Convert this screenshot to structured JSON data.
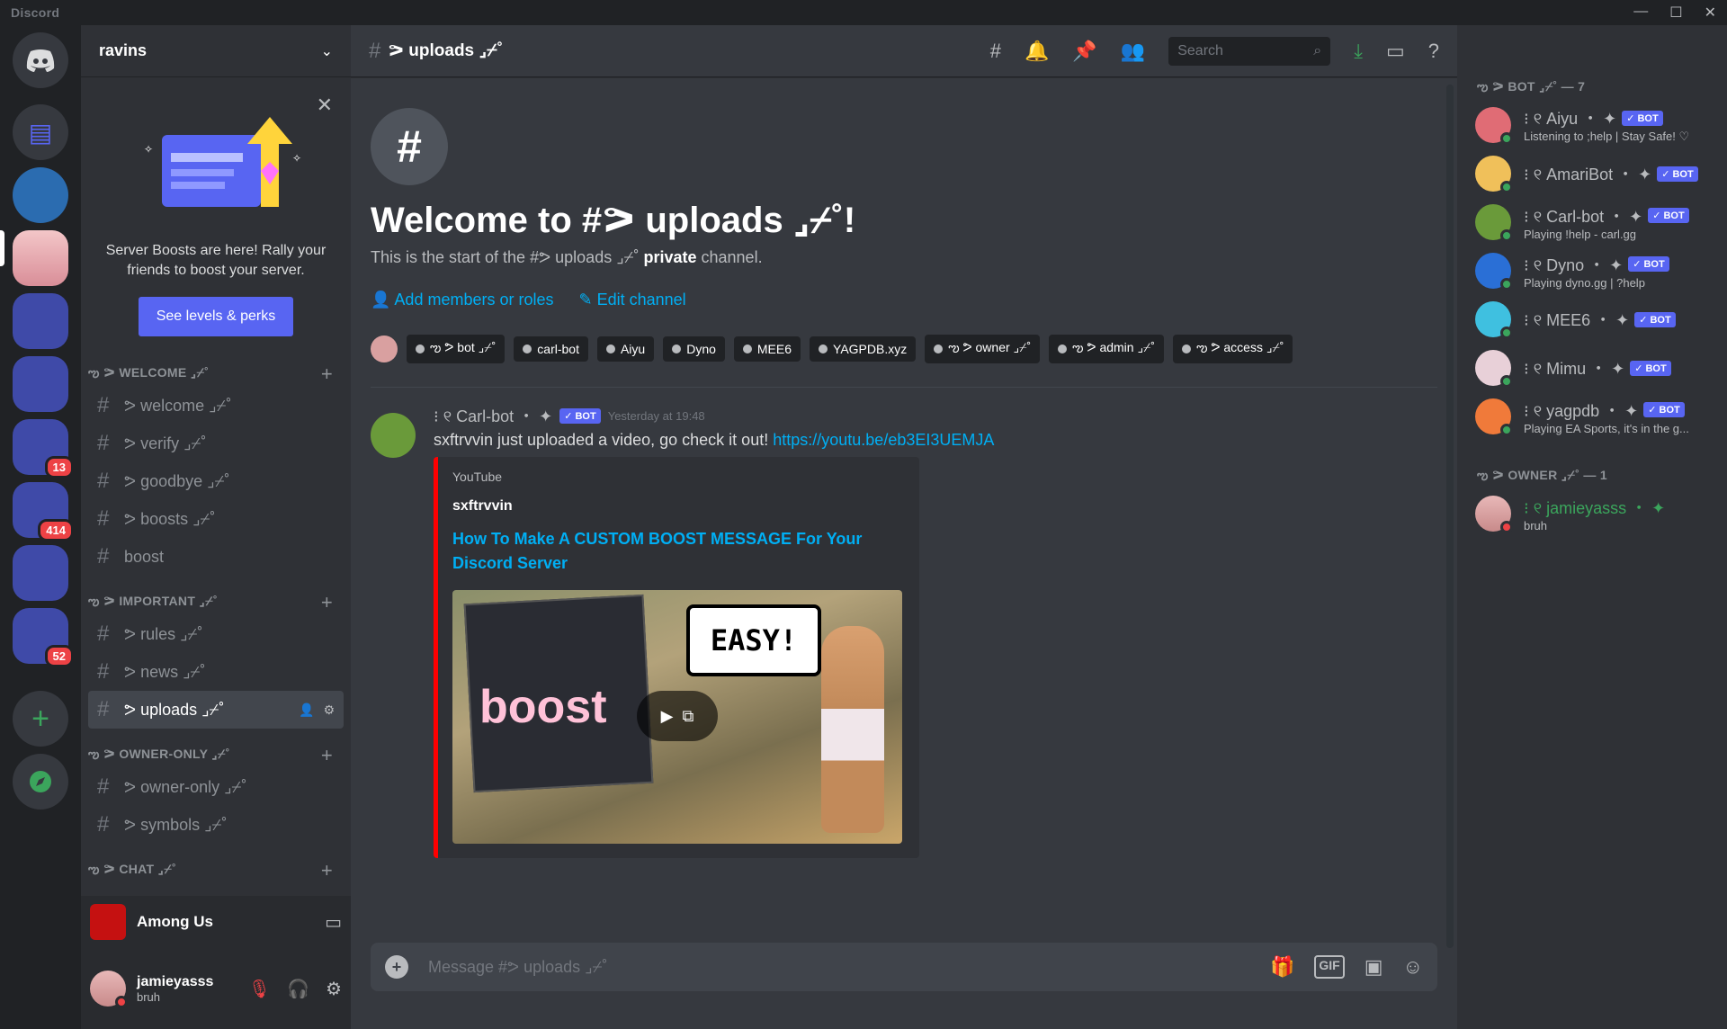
{
  "app": {
    "brand": "Discord"
  },
  "window_controls": [
    "—",
    "☐",
    "✕"
  ],
  "server": {
    "name": "ravins"
  },
  "boost_card": {
    "text": "Server Boosts are here! Rally your friends to boost your server.",
    "button": "See levels & perks"
  },
  "guild_badges": {
    "g1": "13",
    "g2": "414",
    "g3": "52"
  },
  "categories": [
    {
      "name": "ఌ ᕗ WELCOME ⌟⌿˚",
      "channels": [
        {
          "name": "ᕗ welcome ⌟⌿˚"
        },
        {
          "name": "ᕗ verify ⌟⌿˚"
        },
        {
          "name": "ᕗ goodbye ⌟⌿˚"
        },
        {
          "name": "ᕗ boosts ⌟⌿˚"
        },
        {
          "name": "boost"
        }
      ]
    },
    {
      "name": "ఌ ᕗ IMPORTANT ⌟⌿˚",
      "channels": [
        {
          "name": "ᕗ rules ⌟⌿˚"
        },
        {
          "name": "ᕗ news ⌟⌿˚"
        },
        {
          "name": "ᕗ uploads ⌟⌿˚"
        }
      ]
    },
    {
      "name": "ఌ ᕗ OWNER-ONLY ⌟⌿˚",
      "channels": [
        {
          "name": "ᕗ owner-only ⌟⌿˚"
        },
        {
          "name": "ᕗ symbols ⌟⌿˚"
        }
      ]
    },
    {
      "name": "ఌ ᕗ CHAT ⌟⌿˚",
      "channels": []
    }
  ],
  "voice": {
    "activity": "Among Us"
  },
  "user": {
    "name": "jamieyasss",
    "status": "bruh"
  },
  "channel_header": {
    "title": "ᕗ uploads ⌟⌿˚",
    "search_placeholder": "Search"
  },
  "welcome": {
    "title": "Welcome to #ᕗ uploads ⌟⌿˚!",
    "sub_prefix": "This is the start of the #ᕗ uploads ⌟⌿˚",
    "sub_strong": "private",
    "sub_suffix": "channel.",
    "add_members": "Add members or roles",
    "edit_channel": "Edit channel"
  },
  "roles": [
    "ఌ ᕗ bot ⌟⌿˚",
    "carl-bot",
    "Aiyu",
    "Dyno",
    "MEE6",
    "YAGPDB.xyz",
    "ఌ ᕗ owner ⌟⌿˚",
    "ఌ ᕗ admin ⌟⌿˚",
    "ఌ ᕗ access ⌟⌿˚"
  ],
  "message": {
    "author": "⁝ ୧ Carl-bot ・ ✦",
    "badge": "✓ BOT",
    "timestamp": "Yesterday at 19:48",
    "text": "sxftrvvin just uploaded a video, go check it out!",
    "link": "https://youtu.be/eb3EI3UEMJA",
    "embed": {
      "provider": "YouTube",
      "author": "sxftrvvin",
      "title": "How To Make A CUSTOM BOOST MESSAGE For Your Discord Server",
      "thumb_caption": "EASY!",
      "thumb_word": "boost"
    }
  },
  "composer": {
    "placeholder": "Message #ᕗ uploads ⌟⌿˚",
    "gif": "GIF"
  },
  "members": {
    "bot_header": "ఌ ᕗ BOT ⌟⌿˚ — 7",
    "bots": [
      {
        "name": "⁝ ୧ Aiyu ・ ✦",
        "activity": "Listening to ;help | Stay Safe! ♡",
        "color": "#e06c75"
      },
      {
        "name": "⁝ ୧ AmariBot ・ ✦",
        "activity": "",
        "color": "#f0c05a"
      },
      {
        "name": "⁝ ୧ Carl-bot ・ ✦",
        "activity": "Playing !help - carl.gg",
        "color": "#6a9a3a"
      },
      {
        "name": "⁝ ୧ Dyno ・ ✦",
        "activity": "Playing dyno.gg | ?help",
        "color": "#2a6fd6"
      },
      {
        "name": "⁝ ୧ MEE6 ・ ✦",
        "activity": "",
        "color": "#3fc0e0"
      },
      {
        "name": "⁝ ୧ Mimu ・ ✦",
        "activity": "",
        "color": "#e8d0d8"
      },
      {
        "name": "⁝ ୧ yagpdb ・ ✦",
        "activity": "Playing EA Sports, it's in the g...",
        "color": "#f07a3a"
      }
    ],
    "bot_badge": "✓ BOT",
    "owner_header": "ఌ ᕗ OWNER ⌟⌿˚ — 1",
    "owner": {
      "name": "⁝ ୧ jamieyasss ・ ✦",
      "activity": "bruh"
    }
  }
}
